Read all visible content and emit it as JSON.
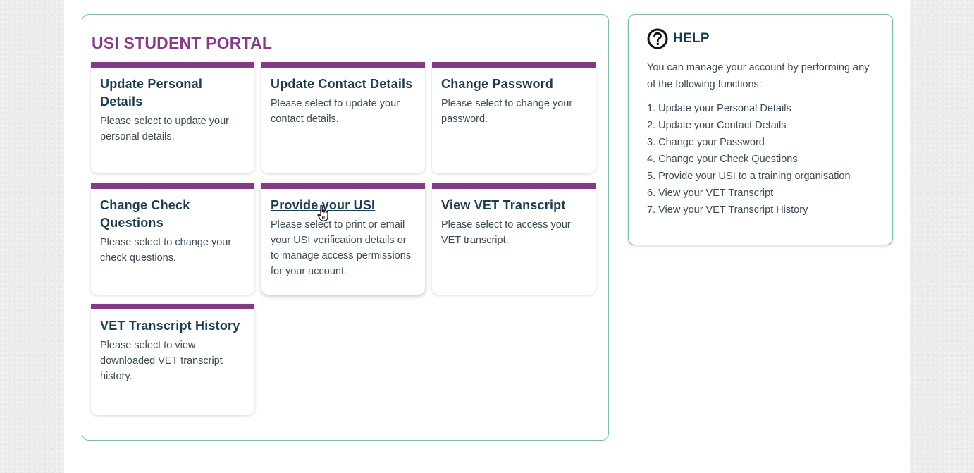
{
  "portal": {
    "title": "USI STUDENT PORTAL",
    "tiles": [
      {
        "title": "Update Personal Details",
        "description": "Please select to update your personal details."
      },
      {
        "title": "Update Contact Details",
        "description": "Please select to update your contact details."
      },
      {
        "title": "Change Password",
        "description": "Please select to change your password."
      },
      {
        "title": "Change Check Questions",
        "description": "Please select to change your check questions."
      },
      {
        "title": "Provide your USI",
        "description": "Please select to print or email your USI verification details or to manage access permissions for your account."
      },
      {
        "title": "View VET Transcript",
        "description": "Please select to access your VET transcript."
      },
      {
        "title": "VET Transcript History",
        "description": "Please select to view downloaded VET transcript history."
      }
    ]
  },
  "help": {
    "icon": "question-circle-icon",
    "title": "HELP",
    "intro": "You can manage your account by performing any of the following functions:",
    "items": [
      "1. Update your Personal Details",
      "2. Update your Contact Details",
      "3. Change your Password",
      "4. Change your Check Questions",
      "5. Provide your USI to a training organisation",
      "6. View your VET Transcript",
      "7. View your VET Transcript History"
    ]
  },
  "cursor": {
    "icon": "hand-pointer-icon"
  },
  "colors": {
    "accent": "#843a85",
    "heading": "#1d3d4e",
    "border": "#7fb8b3"
  }
}
